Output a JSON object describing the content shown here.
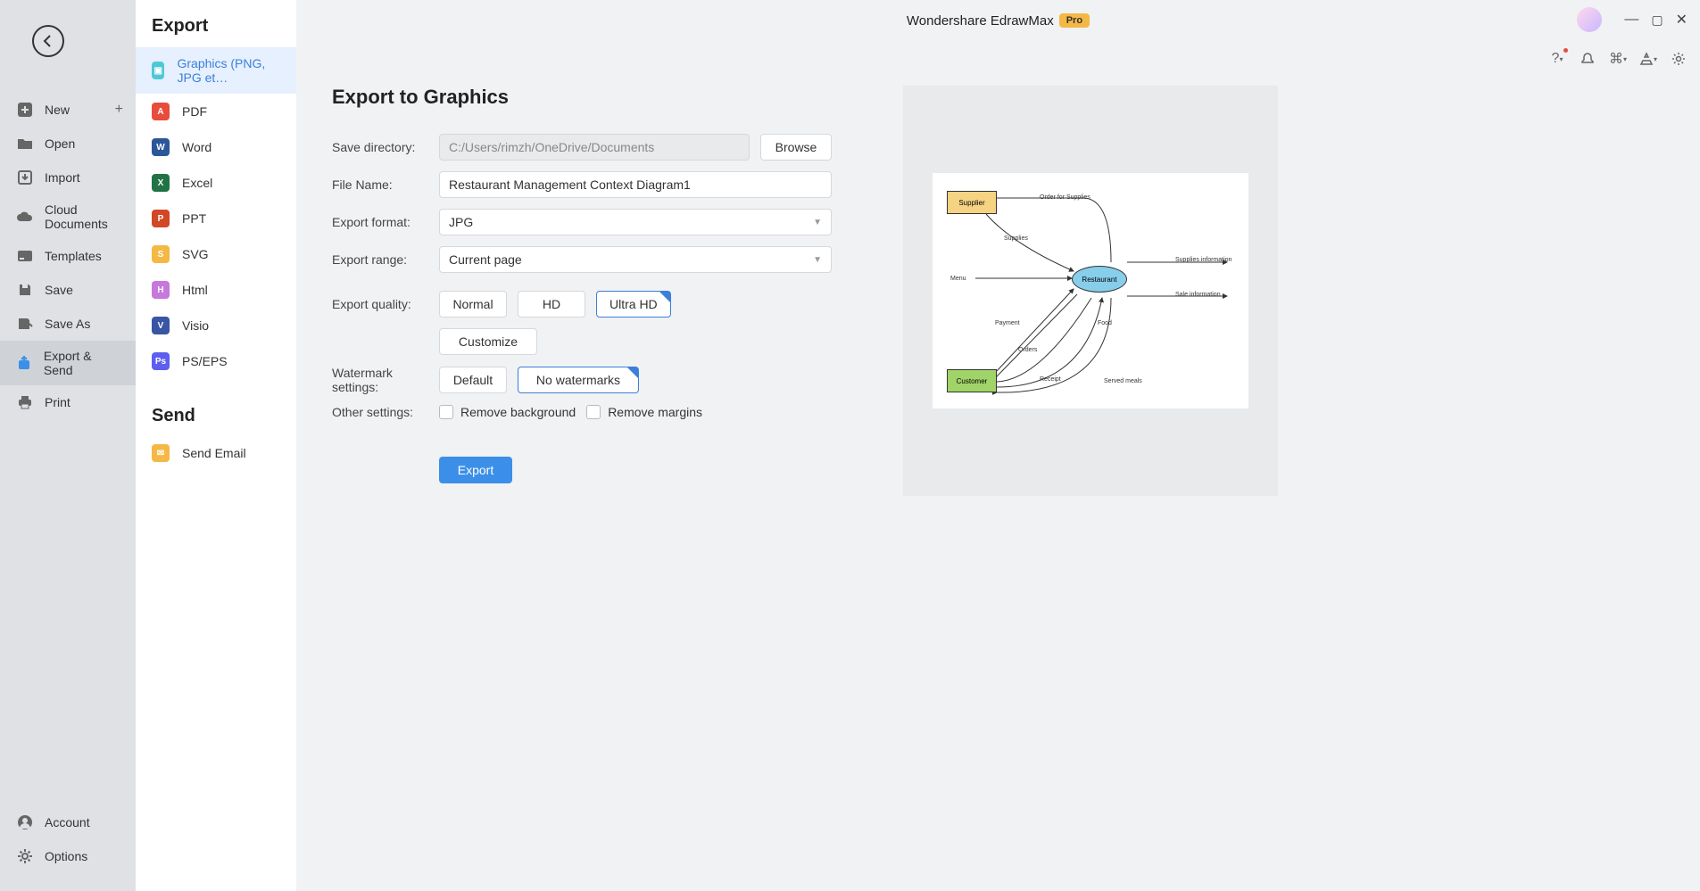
{
  "app": {
    "title": "Wondershare EdrawMax",
    "badge": "Pro"
  },
  "leftNav": {
    "items": [
      {
        "label": "New",
        "icon": "plus-square",
        "hasPlus": true
      },
      {
        "label": "Open",
        "icon": "folder"
      },
      {
        "label": "Import",
        "icon": "import"
      },
      {
        "label": "Cloud Documents",
        "icon": "cloud"
      },
      {
        "label": "Templates",
        "icon": "templates"
      },
      {
        "label": "Save",
        "icon": "save"
      },
      {
        "label": "Save As",
        "icon": "save-as"
      },
      {
        "label": "Export & Send",
        "icon": "export",
        "active": true
      },
      {
        "label": "Print",
        "icon": "print"
      }
    ],
    "bottom": [
      {
        "label": "Account",
        "icon": "person"
      },
      {
        "label": "Options",
        "icon": "gear"
      }
    ]
  },
  "formatPanel": {
    "exportHeading": "Export",
    "sendHeading": "Send",
    "formats": [
      {
        "label": "Graphics (PNG, JPG et…",
        "color": "#4ec9d4",
        "active": true
      },
      {
        "label": "PDF",
        "color": "#e74c3c"
      },
      {
        "label": "Word",
        "color": "#2b579a"
      },
      {
        "label": "Excel",
        "color": "#217346"
      },
      {
        "label": "PPT",
        "color": "#d24726"
      },
      {
        "label": "SVG",
        "color": "#f5b845"
      },
      {
        "label": "Html",
        "color": "#c678dd"
      },
      {
        "label": "Visio",
        "color": "#3955a3"
      },
      {
        "label": "PS/EPS",
        "color": "#5d5fef"
      }
    ],
    "sendItems": [
      {
        "label": "Send Email",
        "color": "#f5b845"
      }
    ]
  },
  "form": {
    "heading": "Export to Graphics",
    "saveDirLabel": "Save directory:",
    "saveDirValue": "C:/Users/rimzh/OneDrive/Documents",
    "browseLabel": "Browse",
    "fileNameLabel": "File Name:",
    "fileNameValue": "Restaurant Management Context Diagram1",
    "formatLabel": "Export format:",
    "formatValue": "JPG",
    "rangeLabel": "Export range:",
    "rangeValue": "Current page",
    "qualityLabel": "Export quality:",
    "qualityOptions": [
      "Normal",
      "HD",
      "Ultra HD"
    ],
    "qualitySelected": "Ultra HD",
    "customizeLabel": "Customize",
    "watermarkLabel": "Watermark settings:",
    "watermarkOptions": [
      "Default",
      "No watermarks"
    ],
    "watermarkSelected": "No watermarks",
    "otherLabel": "Other settings:",
    "removeBg": "Remove background",
    "removeMargins": "Remove margins",
    "exportBtn": "Export"
  },
  "preview": {
    "supplier": "Supplier",
    "restaurant": "Restaurant",
    "customer": "Customer",
    "menu": "Menu",
    "orderSupplies": "Order for Supplies",
    "supplies": "Supplies",
    "suppliesInfo": "Supplies information",
    "saleInfo": "Sale information",
    "payment": "Payment",
    "food": "Food",
    "orders": "Orders",
    "receipt": "Receipt",
    "servedMeals": "Served meals"
  }
}
